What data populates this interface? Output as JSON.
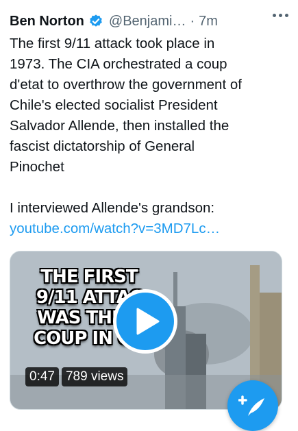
{
  "tweet": {
    "author_name": "Ben Norton",
    "handle": "@Benjami…",
    "separator": "·",
    "time": "7m",
    "text_lines": [
      "The first 9/11 attack took place in",
      "1973. The CIA orchestrated a coup",
      "d'etat to overthrow the government of",
      "Chile's elected socialist President",
      "Salvador Allende, then installed the",
      "fascist dictatorship of General",
      "Pinochet"
    ],
    "text_line2": "I interviewed Allende's grandson:",
    "link": "youtube.com/watch?v=3MD7Lc…"
  },
  "media": {
    "overlay_lines": [
      "THE FIRST",
      "9/11 ATTAC",
      "WAS THE C",
      "COUP IN CH"
    ],
    "duration": "0:47",
    "views": "789 views"
  },
  "colors": {
    "accent": "#1d9bf0",
    "text": "#0f1419",
    "secondary": "#536471"
  },
  "icons": {
    "verified": "verified-badge-icon",
    "more": "more-options-icon",
    "play": "play-icon",
    "compose": "compose-icon"
  }
}
